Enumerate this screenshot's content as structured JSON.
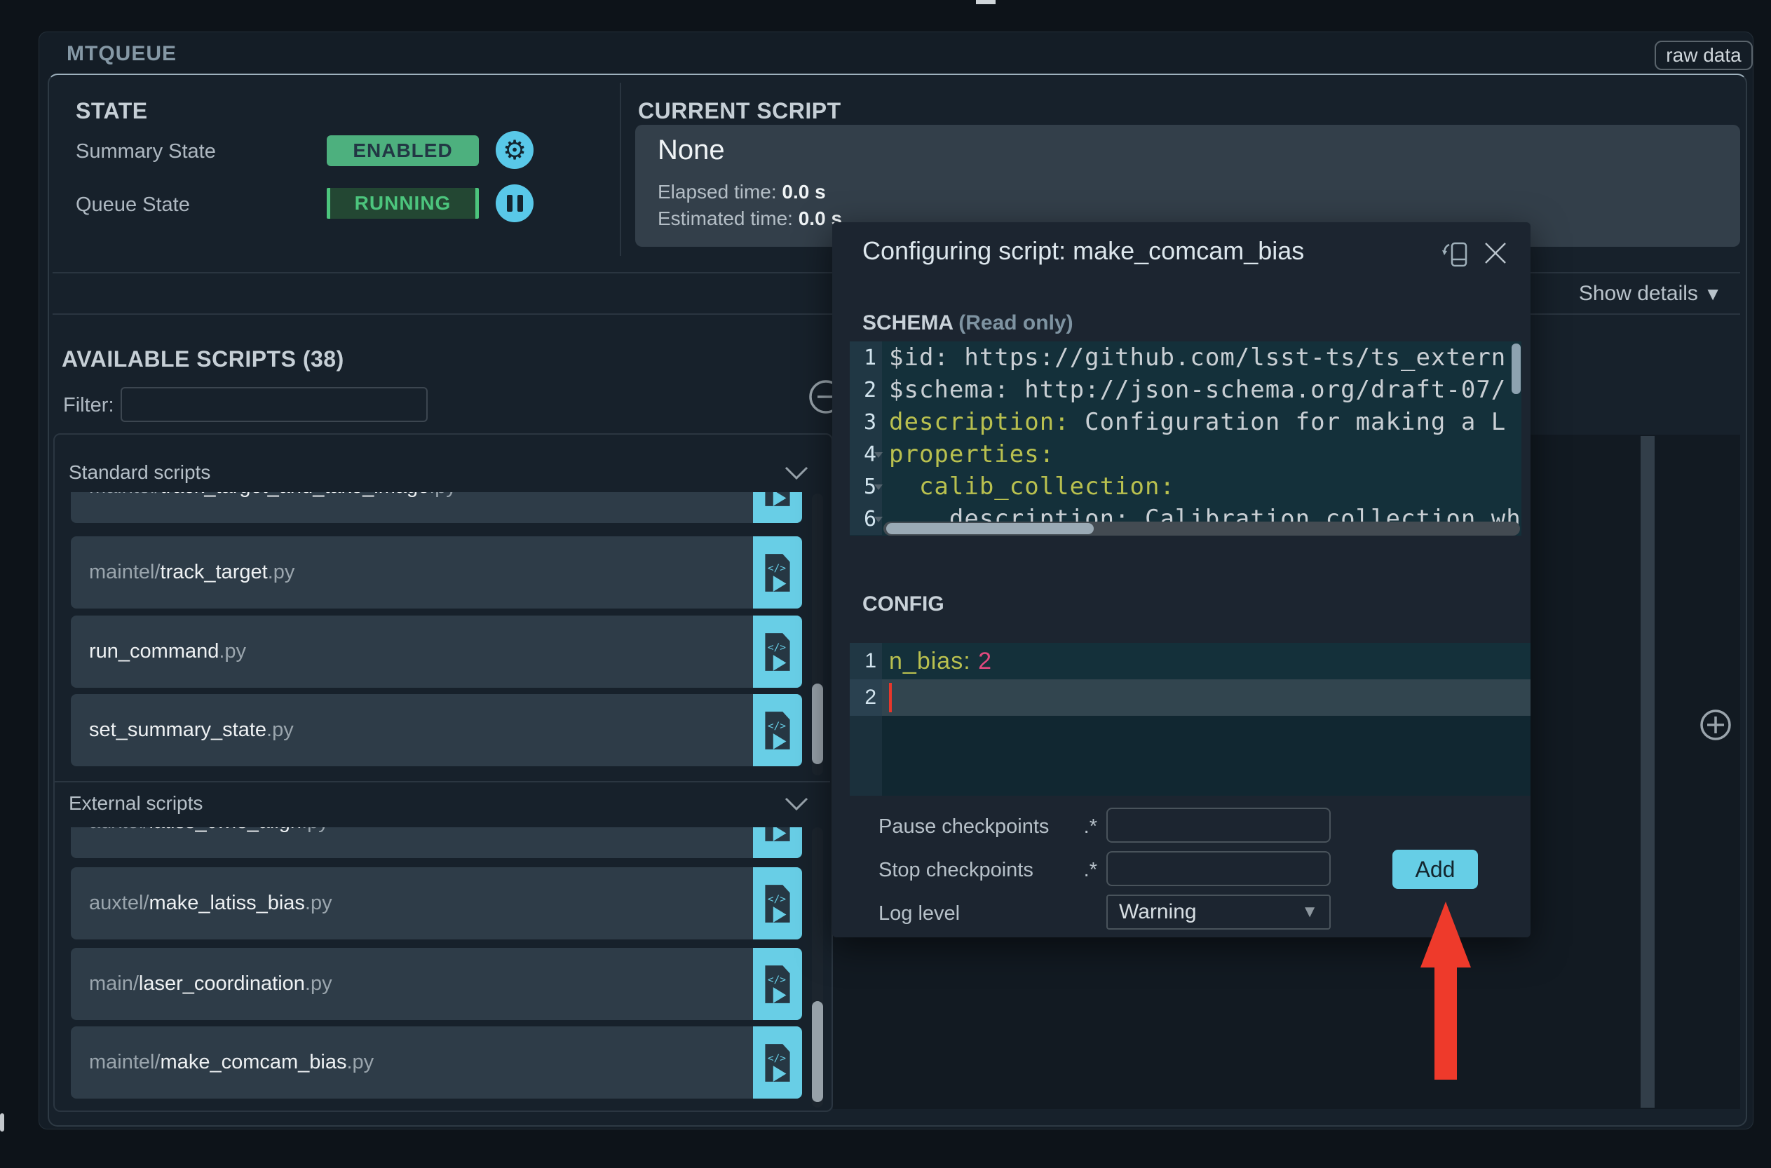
{
  "window": {
    "title": "MTQUEUE",
    "raw_data_label": "raw data"
  },
  "state": {
    "heading": "STATE",
    "summary": {
      "label": "Summary State",
      "value": "ENABLED",
      "icon": "gear-icon"
    },
    "queue": {
      "label": "Queue State",
      "value": "RUNNING",
      "icon": "pause-icon"
    }
  },
  "current_script": {
    "heading": "CURRENT SCRIPT",
    "name": "None",
    "elapsed_label": "Elapsed time:",
    "elapsed_value": "0.0 s",
    "estimated_label": "Estimated time:",
    "estimated_value": "0.0 s"
  },
  "show_details": {
    "label": "Show details",
    "arrow": "▼"
  },
  "available_scripts": {
    "heading": "AVAILABLE SCRIPTS (38)",
    "filter_label": "Filter:",
    "filter_value": "",
    "sections": [
      {
        "title": "Standard scripts",
        "items": [
          {
            "prefix": "maintel/",
            "name": "track_target_and_take_image",
            "ext": ".py",
            "clipped": true
          },
          {
            "prefix": "maintel/",
            "name": "track_target",
            "ext": ".py"
          },
          {
            "prefix": "",
            "name": "run_command",
            "ext": ".py"
          },
          {
            "prefix": "",
            "name": "set_summary_state",
            "ext": ".py"
          }
        ]
      },
      {
        "title": "External scripts",
        "items": [
          {
            "prefix": "auxtel/",
            "name": "latiss_cwfs_align",
            "ext": ".py",
            "clipped": true
          },
          {
            "prefix": "auxtel/",
            "name": "make_latiss_bias",
            "ext": ".py"
          },
          {
            "prefix": "main/",
            "name": "laser_coordination",
            "ext": ".py"
          },
          {
            "prefix": "maintel/",
            "name": "make_comcam_bias",
            "ext": ".py"
          }
        ]
      }
    ]
  },
  "modal": {
    "title": "Configuring script: make_comcam_bias",
    "schema_heading": "SCHEMA",
    "schema_note": "(Read only)",
    "config_heading": "CONFIG",
    "schema_editor": {
      "lines": [
        {
          "num": "1",
          "key": "",
          "text": "$id: https://github.com/lsst-ts/ts_extern"
        },
        {
          "num": "2",
          "key": "",
          "text": "$schema: http://json-schema.org/draft-07/"
        },
        {
          "num": "3",
          "key": "description:",
          "text": " Configuration for making a L"
        },
        {
          "num": "4",
          "key": "properties:",
          "text": ""
        },
        {
          "num": "5",
          "key": "  calib_collection:",
          "text": ""
        },
        {
          "num": "6",
          "key": "",
          "text": "    description: Calibration collection wh"
        }
      ]
    },
    "config_editor": {
      "lines": [
        {
          "num": "1",
          "key": "n_bias: ",
          "value": "2"
        },
        {
          "num": "2",
          "key": "",
          "value": ""
        }
      ]
    },
    "controls": {
      "pause_label": "Pause checkpoints",
      "pause_suffix": ".*",
      "pause_value": "",
      "stop_label": "Stop checkpoints",
      "stop_suffix": ".*",
      "stop_value": "",
      "log_label": "Log level",
      "log_value": "Warning",
      "add_label": "Add"
    }
  },
  "colors": {
    "accent_cyan": "#59c8e8",
    "enabled_green": "#4db07e",
    "running_green": "#4cc57d",
    "key_yellow": "#b9c04f",
    "value_pink": "#e1497e",
    "arrow_red": "#ee3a2b",
    "add_button": "#66cee6"
  }
}
